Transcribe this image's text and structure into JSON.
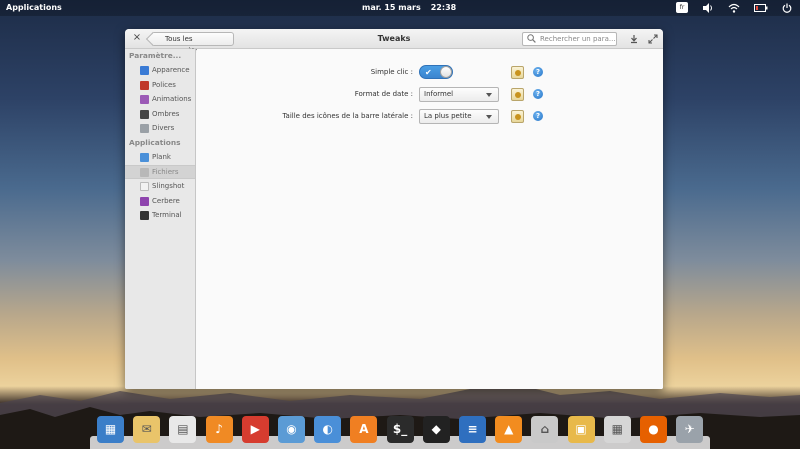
{
  "top_panel": {
    "applications_label": "Applications",
    "date": "mar. 15 mars",
    "time": "22:38",
    "keyboard_layout": "fr"
  },
  "window": {
    "title": "Tweaks",
    "back_button_label": "Tous les paramètres",
    "search_placeholder": "Rechercher un para..."
  },
  "sidebar": {
    "sections": [
      {
        "header": "Paramètre...",
        "items": [
          {
            "label": "Apparence",
            "icon": "appearance-icon",
            "color": "#3a7bd5"
          },
          {
            "label": "Polices",
            "icon": "fonts-icon",
            "color": "#c0392b"
          },
          {
            "label": "Animations",
            "icon": "animations-icon",
            "color": "#9b59b6"
          },
          {
            "label": "Ombres",
            "icon": "shadows-icon",
            "color": "#444444"
          },
          {
            "label": "Divers",
            "icon": "misc-icon",
            "color": "#9aa0a6"
          }
        ]
      },
      {
        "header": "Applications",
        "items": [
          {
            "label": "Plank",
            "icon": "plank-icon",
            "color": "#4a90d9"
          },
          {
            "label": "Fichiers",
            "icon": "files-icon",
            "color": "#b8b8b8",
            "active": true
          },
          {
            "label": "Slingshot",
            "icon": "slingshot-icon",
            "color": "#f2f2f2"
          },
          {
            "label": "Cerbere",
            "icon": "cerbere-icon",
            "color": "#8e44ad"
          },
          {
            "label": "Terminal",
            "icon": "terminal-icon",
            "color": "#333333"
          }
        ]
      }
    ]
  },
  "settings": [
    {
      "label": "Simple clic :",
      "control": "switch",
      "value": true
    },
    {
      "label": "Format de date :",
      "control": "combo",
      "value": "Informel"
    },
    {
      "label": "Taille des icônes de la barre latérale :",
      "control": "combo",
      "value": "La plus petite"
    }
  ],
  "dock": [
    {
      "name": "multitasking-view",
      "icon": "multitasking-icon",
      "color": "#3b7ec8"
    },
    {
      "name": "mail",
      "icon": "mail-icon",
      "color": "#e9c46a"
    },
    {
      "name": "calendar",
      "icon": "calendar-icon",
      "color": "#e8e8e8"
    },
    {
      "name": "music",
      "icon": "music-icon",
      "color": "#f08a24"
    },
    {
      "name": "videos",
      "icon": "videos-icon",
      "color": "#d63c2f"
    },
    {
      "name": "photos",
      "icon": "photos-icon",
      "color": "#5b9bd5"
    },
    {
      "name": "system-settings",
      "icon": "switch-settings-icon",
      "color": "#4a8fd8"
    },
    {
      "name": "app-center",
      "icon": "appcenter-icon",
      "color": "#f07f22"
    },
    {
      "name": "terminal",
      "icon": "terminal-icon",
      "color": "#2b2b2b"
    },
    {
      "name": "inkscape",
      "icon": "inkscape-icon",
      "color": "#222222"
    },
    {
      "name": "document-viewer",
      "icon": "document-icon",
      "color": "#2f6fbf"
    },
    {
      "name": "vlc",
      "icon": "vlc-icon",
      "color": "#f28c1f"
    },
    {
      "name": "files",
      "icon": "folder-home-icon",
      "color": "#c9c9c9"
    },
    {
      "name": "shotwell",
      "icon": "shotwell-icon",
      "color": "#e8b94a"
    },
    {
      "name": "calculator",
      "icon": "calculator-icon",
      "color": "#d6d6d6"
    },
    {
      "name": "firefox",
      "icon": "firefox-icon",
      "color": "#e66000"
    },
    {
      "name": "eidete",
      "icon": "rocket-icon",
      "color": "#9aa2aa"
    }
  ]
}
